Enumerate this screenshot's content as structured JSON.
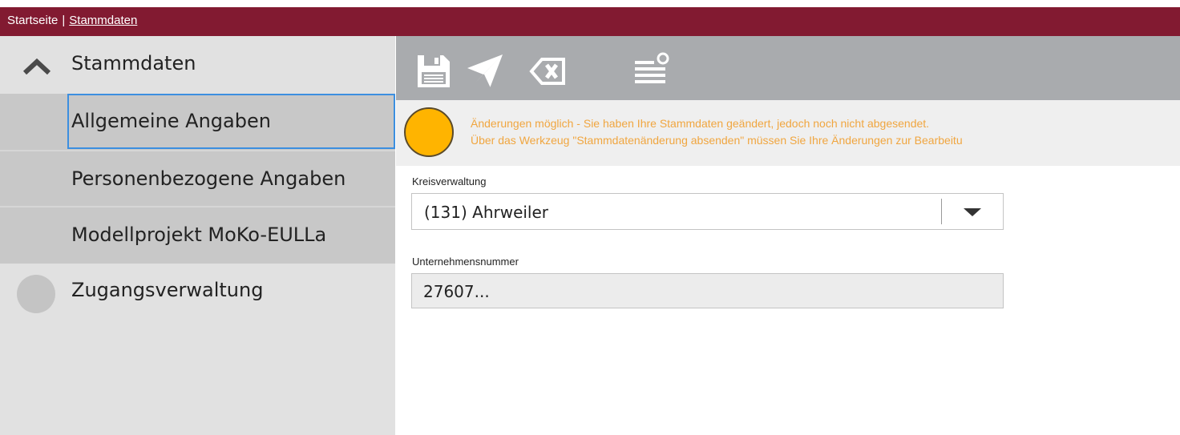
{
  "breadcrumb": {
    "home": "Startseite",
    "separator": "|",
    "current": "Stammdaten"
  },
  "sidebar": {
    "section_label": "Stammdaten",
    "items": [
      {
        "label": "Allgemeine Angaben",
        "selected": true
      },
      {
        "label": "Personenbezogene Angaben",
        "selected": false
      },
      {
        "label": "Modellprojekt MoKo-EULLa",
        "selected": false
      }
    ],
    "access_label": "Zugangsverwaltung"
  },
  "toolbar": {
    "tools": [
      "save-icon",
      "send-icon",
      "clear-icon",
      "list-settings-icon"
    ]
  },
  "notice": {
    "status_color": "#ffb400",
    "line1": "Änderungen möglich - Sie haben Ihre Stammdaten geändert, jedoch noch nicht abgesendet.",
    "line2": "Über das Werkzeug \"Stammdatenänderung absenden\" müssen Sie Ihre Änderungen zur Bearbeitu"
  },
  "form": {
    "kreis_label": "Kreisverwaltung",
    "kreis_value": "(131) Ahrweiler",
    "unternehmen_label": "Unternehmensnummer",
    "unternehmen_value": "27607..."
  },
  "colors": {
    "topbar": "#821a31",
    "accent_focus": "#3c8fe0",
    "notice_text": "#f0a640"
  }
}
